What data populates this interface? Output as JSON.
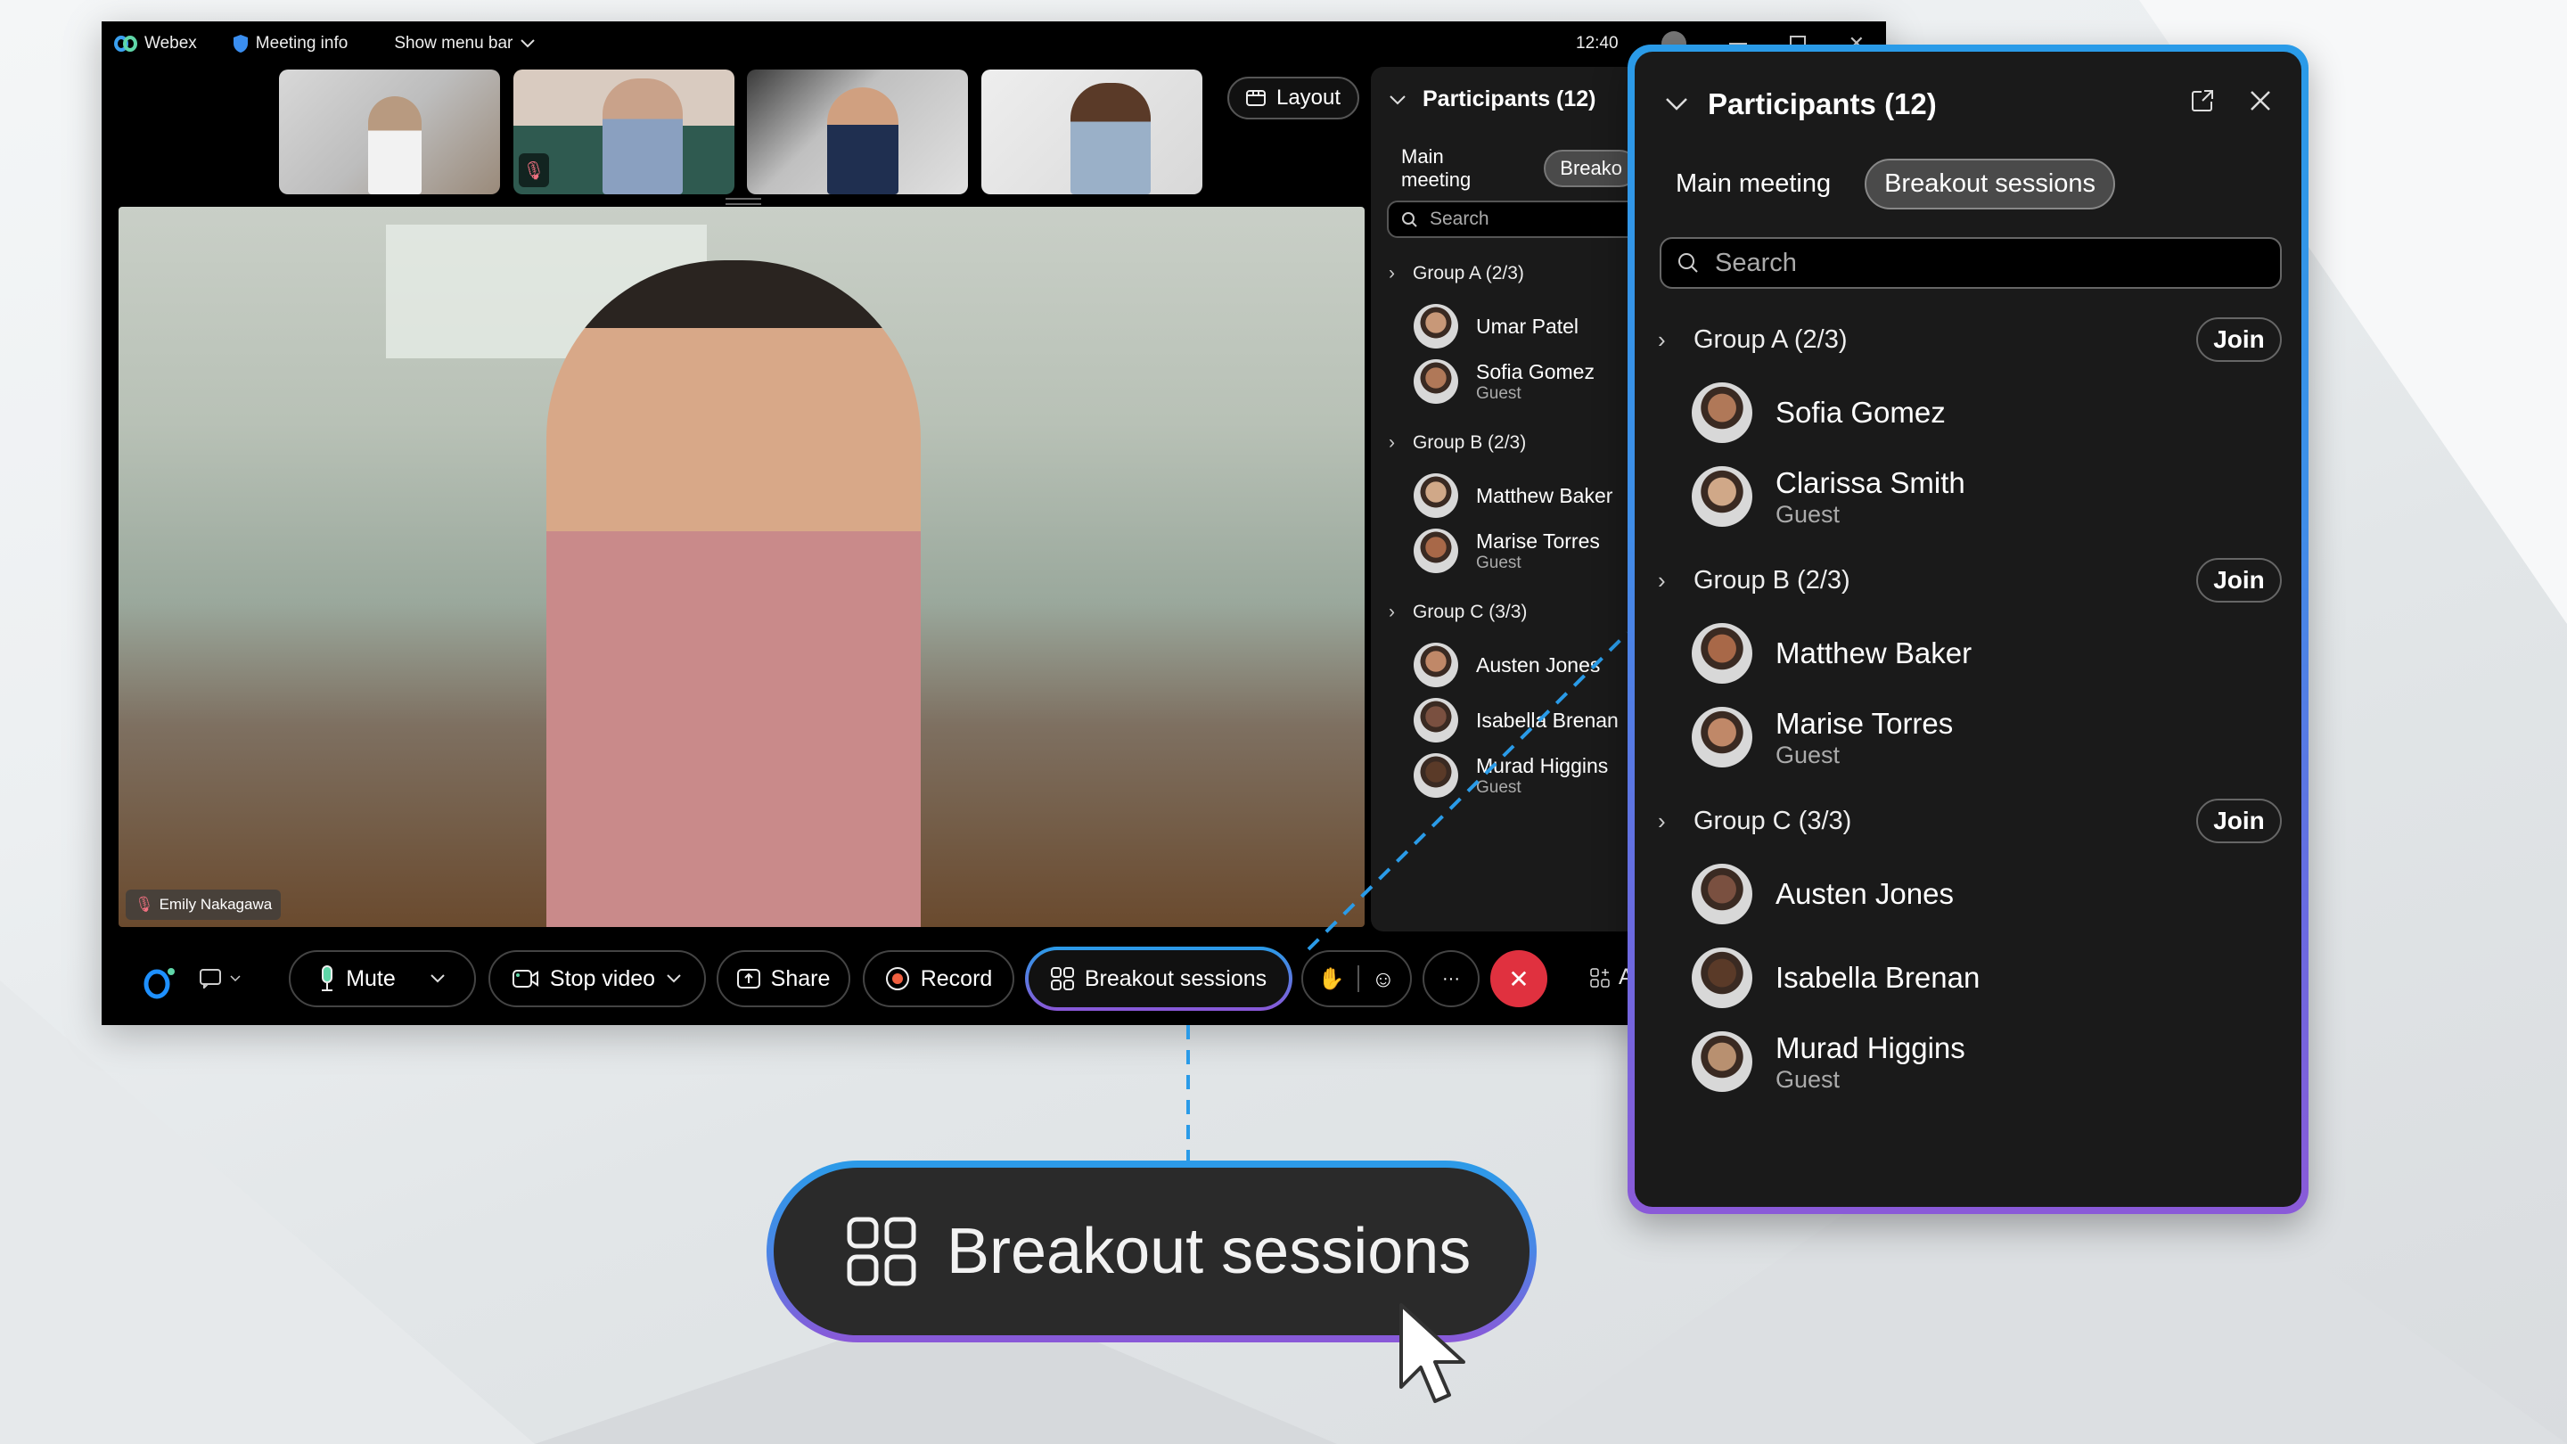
{
  "titlebar": {
    "app_name": "Webex",
    "meeting_info": "Meeting info",
    "show_menu_bar": "Show menu bar",
    "time": "12:40"
  },
  "layout_button": "Layout",
  "thumbnails": [
    {
      "muted": false
    },
    {
      "muted": true
    },
    {
      "muted": false
    },
    {
      "muted": false
    }
  ],
  "main_video": {
    "name": "Emily Nakagawa",
    "muted": true
  },
  "participants_panel_back": {
    "title": "Participants (12)",
    "tabs": [
      "Main meeting",
      "Breako"
    ],
    "search_placeholder": "Search",
    "groups": [
      {
        "label": "Group A (2/3)",
        "members": [
          {
            "name": "Umar Patel",
            "sub": ""
          },
          {
            "name": "Sofia Gomez",
            "sub": "Guest"
          }
        ]
      },
      {
        "label": "Group B (2/3)",
        "members": [
          {
            "name": "Matthew Baker",
            "sub": ""
          },
          {
            "name": "Marise Torres",
            "sub": "Guest"
          }
        ]
      },
      {
        "label": "Group C (3/3)",
        "members": [
          {
            "name": "Austen Jones",
            "sub": ""
          },
          {
            "name": "Isabella Brenan",
            "sub": ""
          },
          {
            "name": "Murad Higgins",
            "sub": "Guest"
          }
        ]
      }
    ]
  },
  "controls": {
    "mute": "Mute",
    "stop_video": "Stop video",
    "share": "Share",
    "record": "Record",
    "breakout": "Breakout sessions",
    "more": "···",
    "apps_partial": "A"
  },
  "participants_panel": {
    "title": "Participants (12)",
    "tabs": [
      {
        "label": "Main meeting",
        "active": false
      },
      {
        "label": "Breakout sessions",
        "active": true
      }
    ],
    "search_placeholder": "Search",
    "join_label": "Join",
    "groups": [
      {
        "label": "Group A (2/3)",
        "members": [
          {
            "name": "Sofia Gomez",
            "sub": ""
          },
          {
            "name": "Clarissa Smith",
            "sub": "Guest"
          }
        ]
      },
      {
        "label": "Group B (2/3)",
        "members": [
          {
            "name": "Matthew Baker",
            "sub": ""
          },
          {
            "name": "Marise Torres",
            "sub": "Guest"
          }
        ]
      },
      {
        "label": "Group C (3/3)",
        "members": [
          {
            "name": "Austen Jones",
            "sub": ""
          },
          {
            "name": "Isabella Brenan",
            "sub": ""
          },
          {
            "name": "Murad Higgins",
            "sub": "Guest"
          }
        ]
      }
    ]
  },
  "callout": {
    "label": "Breakout sessions"
  },
  "colors": {
    "accent_blue": "#2a9be8",
    "accent_purple": "#8a58d8",
    "end_call_red": "#e0313f",
    "record_dot": "#f06040",
    "mic_green": "#5fd6a8",
    "panel_bg": "#1a1a1a"
  }
}
